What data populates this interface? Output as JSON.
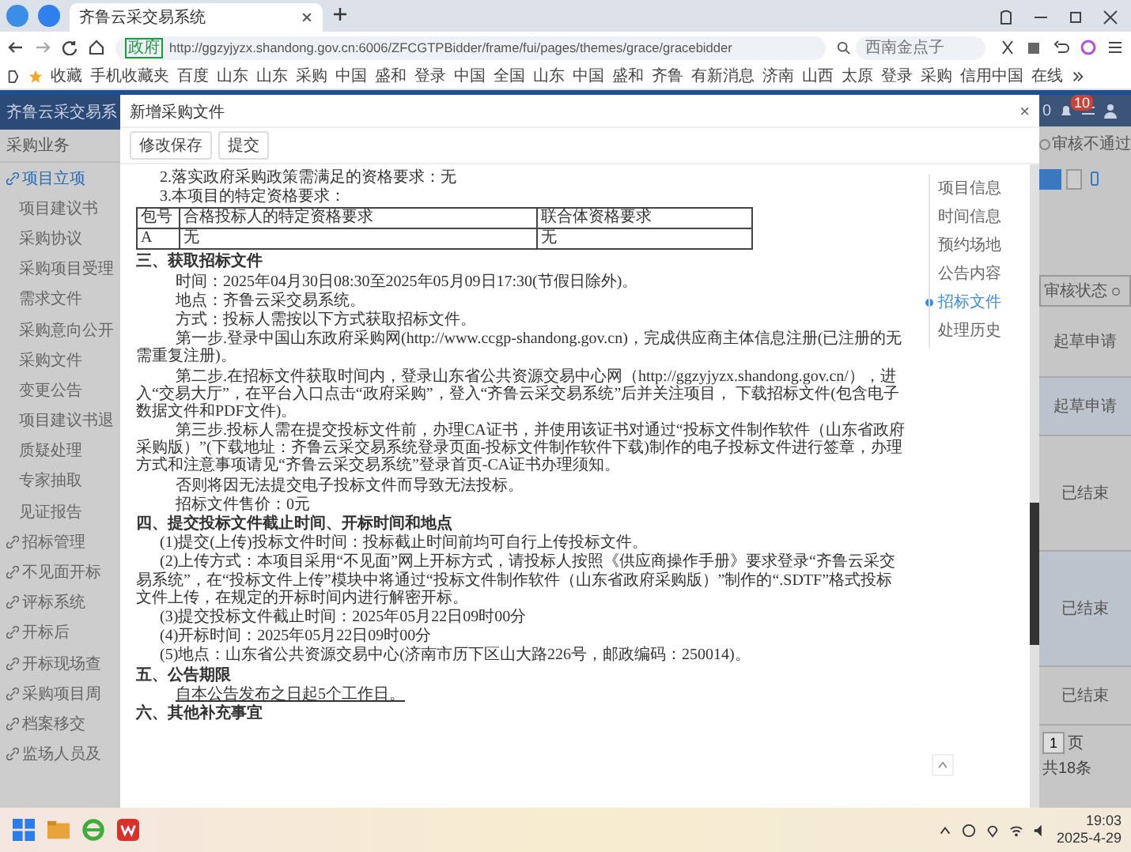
{
  "browser": {
    "tab_title": "齐鲁云采交易系统",
    "address_badge": "政府",
    "url": "http://ggzyjyzx.shandong.gov.cn:6006/ZFCGTPBidder/frame/fui/pages/themes/grace/gracebidder",
    "search_placeholder": "西南金点子",
    "bookmarks": [
      "收藏",
      "手机收藏夹",
      "百度",
      "山东",
      "山东",
      "采购",
      "中国",
      "盛和",
      "登录",
      "中国",
      "全国",
      "山东",
      "中国",
      "盛和",
      "齐鲁",
      "有新消息",
      "济南",
      "山西",
      "太原",
      "登录",
      "采购",
      "信用中国",
      "在线"
    ]
  },
  "sidebar": {
    "title": "齐鲁云采交易系",
    "section": "采购业务",
    "items": [
      {
        "label": "项目立项",
        "kind": "group",
        "selected": true
      },
      {
        "label": "项目建议书",
        "kind": "sub",
        "selected": false
      },
      {
        "label": "采购协议",
        "kind": "sub",
        "selected": false
      },
      {
        "label": "采购项目受理",
        "kind": "sub",
        "selected": false
      },
      {
        "label": "需求文件",
        "kind": "sub",
        "selected": false
      },
      {
        "label": "采购意向公开",
        "kind": "sub",
        "selected": false
      },
      {
        "label": "采购文件",
        "kind": "sub",
        "selected": false
      },
      {
        "label": "变更公告",
        "kind": "sub",
        "selected": false
      },
      {
        "label": "项目建议书退",
        "kind": "sub",
        "selected": false
      },
      {
        "label": "质疑处理",
        "kind": "sub",
        "selected": false
      },
      {
        "label": "专家抽取",
        "kind": "sub",
        "selected": false
      },
      {
        "label": "见证报告",
        "kind": "sub",
        "selected": false
      },
      {
        "label": "招标管理",
        "kind": "group",
        "selected": false
      },
      {
        "label": "不见面开标",
        "kind": "group",
        "selected": false
      },
      {
        "label": "评标系统",
        "kind": "group",
        "selected": false
      },
      {
        "label": "开标后",
        "kind": "group",
        "selected": false
      },
      {
        "label": "开标现场查",
        "kind": "group",
        "selected": false
      },
      {
        "label": "采购项目周",
        "kind": "group",
        "selected": false
      },
      {
        "label": "档案移交",
        "kind": "group",
        "selected": false
      },
      {
        "label": "监场人员及",
        "kind": "group",
        "selected": false
      }
    ]
  },
  "modal": {
    "title": "新增采购文件",
    "close": "×",
    "buttons": [
      "修改保存",
      "提交"
    ],
    "blocks": [
      {
        "kind": "item",
        "text": "2.落实政府采购政策需满足的资格要求：无"
      },
      {
        "kind": "item",
        "text": "3.本项目的特定资格要求："
      },
      {
        "kind": "table",
        "columns": [
          "包号",
          "合格投标人的特定资格要求",
          "联合体资格要求"
        ],
        "rows": [
          [
            "A",
            "无",
            "无"
          ]
        ]
      },
      {
        "kind": "heading",
        "text": "三、获取招标文件"
      },
      {
        "kind": "para",
        "text": "时间：2025年04月30日08:30至2025年05月09日17:30(节假日除外)。"
      },
      {
        "kind": "para",
        "text": "地点：齐鲁云采交易系统。"
      },
      {
        "kind": "para",
        "text": "方式：投标人需按以下方式获取招标文件。"
      },
      {
        "kind": "para",
        "text": "第一步.登录中国山东政府采购网(http://www.ccgp-shandong.gov.cn)，完成供应商主体信息注册(已注册的无需重复注册)。"
      },
      {
        "kind": "para",
        "text": "第二步.在招标文件获取时间内，登录山东省公共资源交易中心网（http://ggzyjyzx.shandong.gov.cn/），进入“交易大厅”，在平台入口点击“政府采购”，登入“齐鲁云采交易系统”后并关注项目， 下载招标文件(包含电子数据文件和PDF文件)。"
      },
      {
        "kind": "para",
        "text": "第三步.投标人需在提交投标文件前，办理CA证书，并使用该证书对通过“投标文件制作软件（山东省政府采购版）”(下载地址：齐鲁云采交易系统登录页面-投标文件制作软件下载)制作的电子投标文件进行签章，办理方式和注意事项请见“齐鲁云采交易系统”登录首页-CA证书办理须知。"
      },
      {
        "kind": "para",
        "text": "否则将因无法提交电子投标文件而导致无法投标。"
      },
      {
        "kind": "para",
        "text": "招标文件售价：0元"
      },
      {
        "kind": "heading",
        "text": "四、提交投标文件截止时间、开标时间和地点"
      },
      {
        "kind": "item",
        "text": "(1)提交(上传)投标文件时间：投标截止时间前均可自行上传投标文件。"
      },
      {
        "kind": "item",
        "text": "(2)上传方式：本项目采用“不见面”网上开标方式，请投标人按照《供应商操作手册》要求登录“齐鲁云采交易系统”，在“投标文件上传”模块中将通过“投标文件制作软件（山东省政府采购版）”制作的“.SDTF”格式投标文件上传，在规定的开标时间内进行解密开标。"
      },
      {
        "kind": "item",
        "text": "(3)提交投标文件截止时间：2025年05月22日09时00分"
      },
      {
        "kind": "item",
        "text": "(4)开标时间：2025年05月22日09时00分"
      },
      {
        "kind": "item",
        "text": "(5)地点：山东省公共资源交易中心(济南市历下区山大路226号，邮政编码：250014)。"
      },
      {
        "kind": "heading",
        "text": "五、公告期限"
      },
      {
        "kind": "note",
        "text": "自本公告发布之日起5个工作日。"
      },
      {
        "kind": "heading",
        "text": "六、其他补充事宜"
      }
    ],
    "nav": [
      {
        "label": "项目信息",
        "selected": false
      },
      {
        "label": "时间信息",
        "selected": false
      },
      {
        "label": "预约场地",
        "selected": false
      },
      {
        "label": "公告内容",
        "selected": false
      },
      {
        "label": "招标文件",
        "selected": true
      },
      {
        "label": "处理历史",
        "selected": false
      }
    ]
  },
  "background_page": {
    "counter": "0",
    "badge": "10",
    "filter_option": "审核不通过",
    "filter_checked": false,
    "column_header": "审核状态",
    "rows": [
      "起草申请",
      "起草申请",
      "已结束",
      "已结束",
      "已结束"
    ],
    "page_input": "1",
    "page_unit": "页",
    "total": "共18条"
  },
  "taskbar": {
    "time": "19:03",
    "date": "2025-4-29"
  }
}
